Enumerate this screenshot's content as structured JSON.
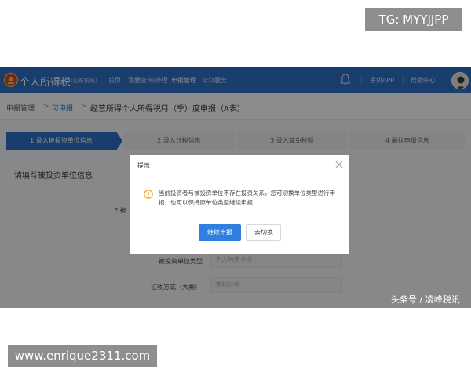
{
  "overlays": {
    "tg_label": "TG: MYYJJPP",
    "site_label": "www.enrique2311.com",
    "source_tag": "头条号 / 凌峰税讯"
  },
  "topbar": {
    "app_title": "个人所得税",
    "region": "（山东税局）",
    "nav": [
      "首页",
      "我要查询/办理",
      "申报管理",
      "公众服务"
    ],
    "active_nav": "申报管理",
    "mobile_app": "手机APP",
    "help_center": "帮助中心"
  },
  "breadcrumb": {
    "root": "申报管理",
    "current": "可申报",
    "separator": ">",
    "form_title": "经营所得个人所得税月（季）度申报（A表）"
  },
  "steps": [
    {
      "label": "1 录入被投资单位信息",
      "active": true
    },
    {
      "label": "2 录入计税信息",
      "active": false
    },
    {
      "label": "3 录入减免税额",
      "active": false
    },
    {
      "label": "4 确认申报信息",
      "active": false
    }
  ],
  "form": {
    "section_title": "请填写被投资单位信息",
    "asterisk_label": "* 被",
    "unit_type_label": "被投资单位类型",
    "unit_type_value": "个人独资企业",
    "levy_label": "征收方式（大类）",
    "levy_value": "查账征收"
  },
  "modal": {
    "title": "提示",
    "message": "当前投资者与被投资单位不存在投资关系，您可切换单位类型进行申报，也可以保持原单位类型继续申报",
    "primary_button": "继续申报",
    "secondary_button": "去切换"
  },
  "colors": {
    "brand_blue": "#2f6fc6",
    "primary_button": "#2f7fe0",
    "warning": "#f0a020"
  }
}
